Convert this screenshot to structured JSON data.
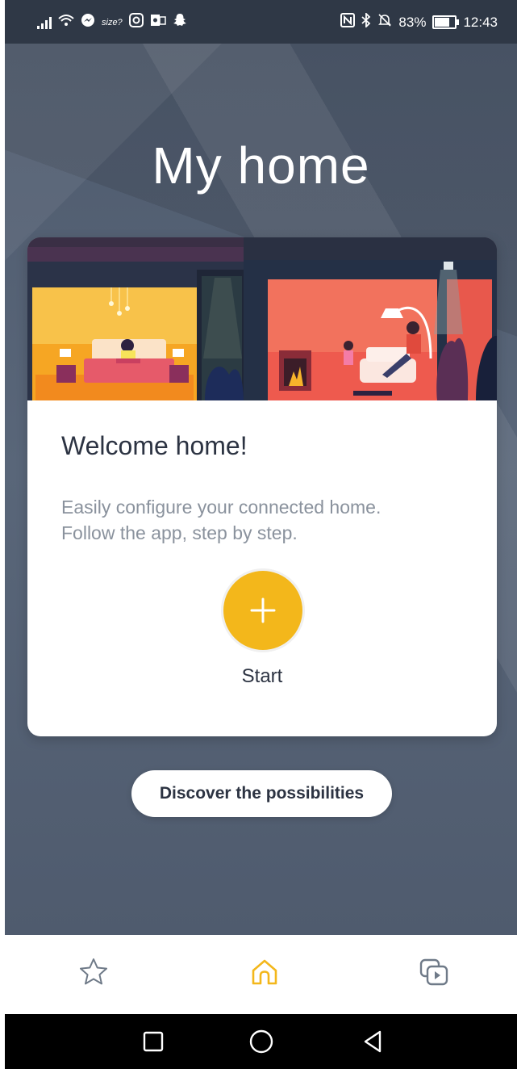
{
  "status_bar": {
    "battery_percent": "83%",
    "time": "12:43",
    "battery_level": 0.83,
    "left_icons": [
      "signal-icon",
      "wifi-icon",
      "messenger-icon",
      "size-app-icon",
      "instagram-icon",
      "outlook-icon",
      "snapchat-icon"
    ],
    "right_icons": [
      "nfc-icon",
      "bluetooth-icon",
      "mute-icon",
      "battery-icon"
    ],
    "size_label": "size?"
  },
  "page": {
    "title": "My home"
  },
  "welcome_card": {
    "heading": "Welcome home!",
    "description_line1": "Easily configure your connected home.",
    "description_line2": "Follow the app, step by step.",
    "start_label": "Start"
  },
  "discover_button": {
    "label": "Discover the possibilities"
  },
  "bottom_nav": {
    "items": [
      {
        "icon": "star-icon",
        "active": false
      },
      {
        "icon": "home-icon",
        "active": true
      },
      {
        "icon": "media-icon",
        "active": false
      }
    ]
  },
  "colors": {
    "accent": "#f3b71b",
    "background": "#535f72",
    "card_text": "#2c3342",
    "muted_text": "#8a929d"
  }
}
